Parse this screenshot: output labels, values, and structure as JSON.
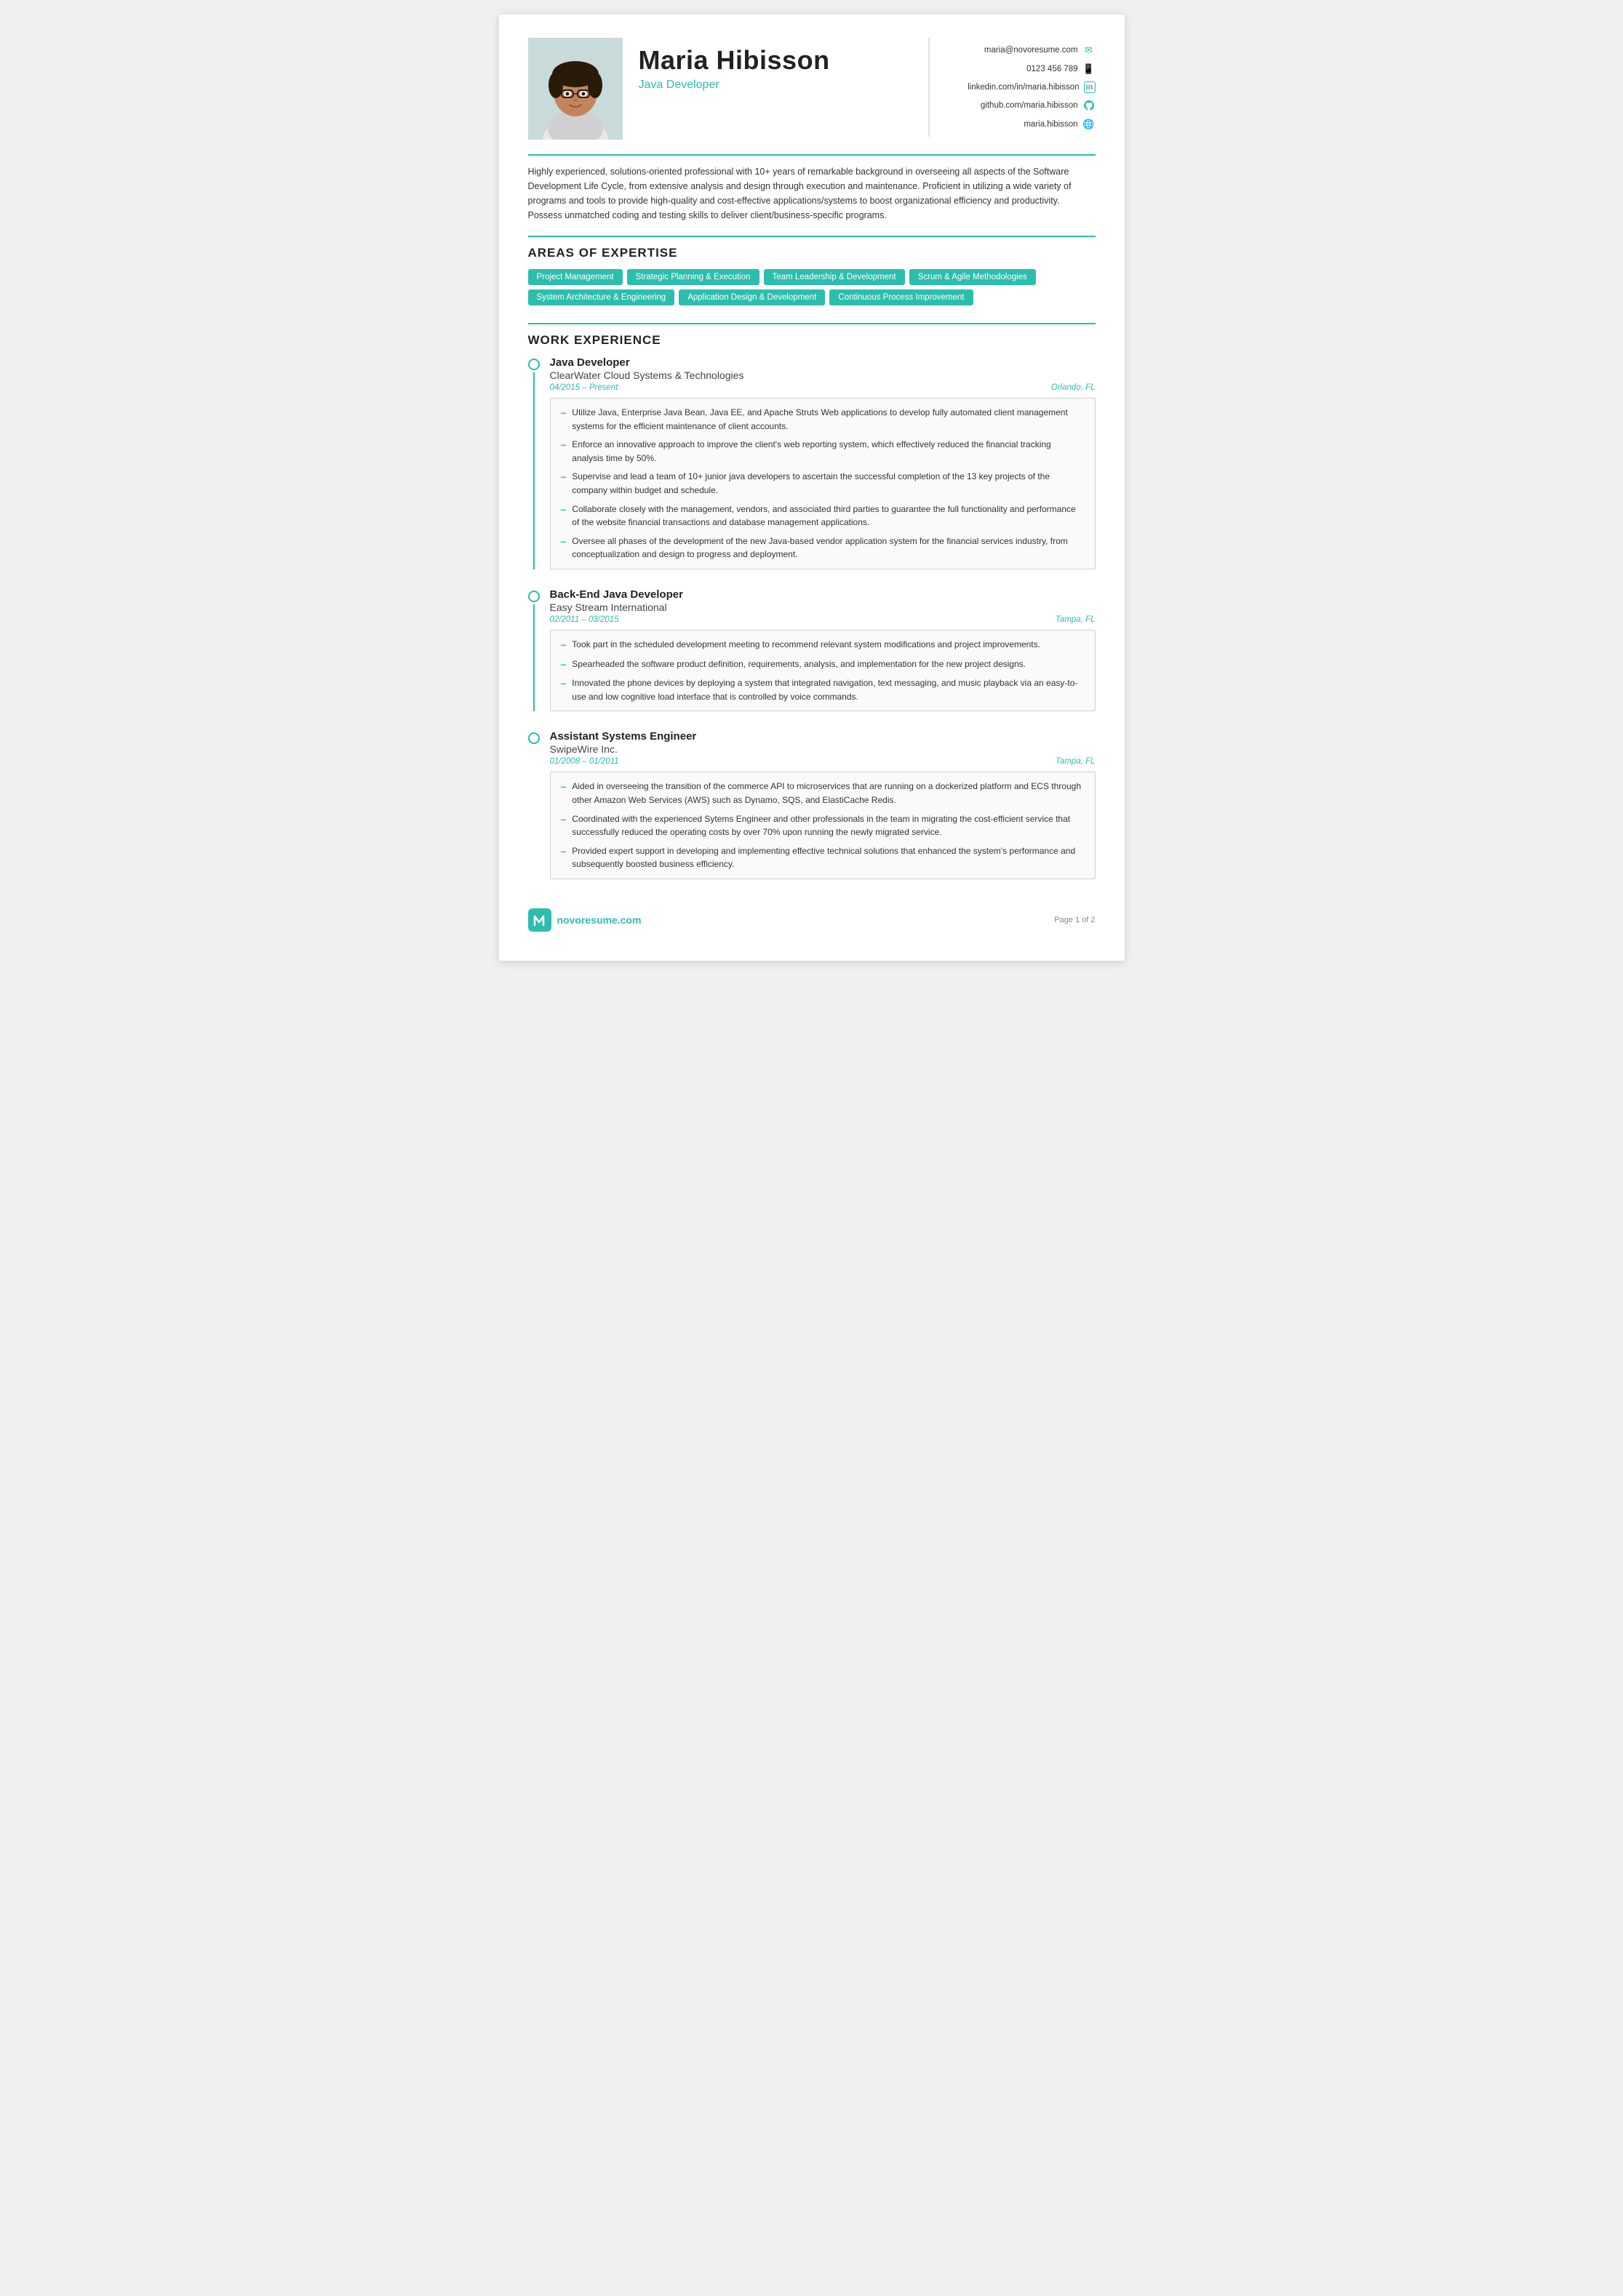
{
  "header": {
    "name": "Maria Hibisson",
    "job_title": "Java Developer",
    "contact": {
      "email": "maria@novoresume.com",
      "phone": "0123 456 789",
      "linkedin": "linkedin.com/in/maria.hibisson",
      "github": "github.com/maria.hibisson",
      "portfolio": "maria.hibisson"
    }
  },
  "summary": "Highly experienced, solutions-oriented professional with 10+ years of remarkable background in overseeing all aspects of the Software Development Life Cycle, from extensive analysis and design through execution and maintenance. Proficient in utilizing a wide variety of programs and tools to provide high-quality and cost-effective applications/systems to boost organizational efficiency and productivity. Possess unmatched coding and testing skills to deliver client/business-specific programs.",
  "sections": {
    "expertise_title": "AREAS OF EXPERTISE",
    "expertise_tags_row1": [
      "Project Management",
      "Strategic Planning & Execution",
      "Team Leadership & Development",
      "Scrum & Agile Methodologies"
    ],
    "expertise_tags_row2": [
      "System Architecture & Engineering",
      "Application Design & Development",
      "Continuous Process Improvement"
    ],
    "work_experience_title": "WORK EXPERIENCE",
    "jobs": [
      {
        "title": "Java Developer",
        "company": "ClearWater Cloud Systems & Technologies",
        "dates": "04/2015 – Present",
        "location": "Orlando, FL",
        "bullets": [
          "Utilize Java, Enterprise Java Bean, Java EE, and Apache Struts Web applications to develop fully automated client management systems for the efficient maintenance of client accounts.",
          "Enforce an innovative approach to improve the client's web reporting system, which effectively reduced the financial tracking analysis time by 50%.",
          "Supervise and lead a team of 10+ junior java developers to ascertain the successful completion of the 13 key projects of the company within budget and schedule.",
          "Collaborate closely with the management, vendors, and associated third parties to guarantee the full functionality and performance of the website financial transactions and database management applications.",
          "Oversee all phases of the development of the new Java-based vendor application system for the financial services industry, from conceptualization and design to progress and deployment."
        ]
      },
      {
        "title": "Back-End Java Developer",
        "company": "Easy Stream International",
        "dates": "02/2011 – 03/2015",
        "location": "Tampa, FL",
        "bullets": [
          "Took part in the scheduled development meeting to recommend relevant system modifications and project improvements.",
          "Spearheaded the software product definition, requirements, analysis, and implementation for the new project designs.",
          "Innovated the phone devices by deploying a system that integrated navigation, text messaging, and music playback via an easy-to-use and low cognitive load interface that is controlled by voice commands."
        ]
      },
      {
        "title": "Assistant Systems Engineer",
        "company": "SwipeWire Inc.",
        "dates": "01/2008 – 01/2011",
        "location": "Tampa, FL",
        "bullets": [
          "Aided in overseeing the transition of the commerce API to microservices that are running on a dockerized platform and ECS through other Amazon Web Services (AWS) such as Dynamo, SQS, and ElastiCache Redis.",
          "Coordinated with the experienced Sytems Engineer and other professionals in the team in migrating the cost-efficient service that successfully reduced the operating costs by over 70% upon running the newly migrated service.",
          "Provided expert support in developing and implementing effective technical solutions that enhanced the system's performance and subsequently boosted business efficiency."
        ]
      }
    ]
  },
  "footer": {
    "logo_text": "novoresume.com",
    "page_text": "Page 1 of 2"
  }
}
